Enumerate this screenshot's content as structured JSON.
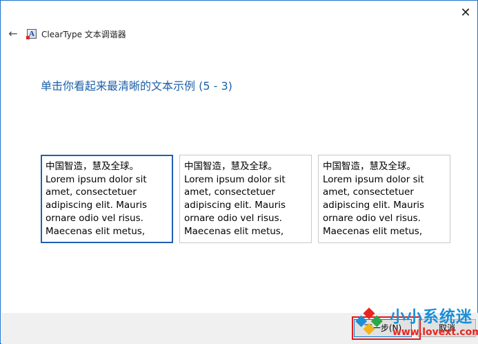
{
  "window": {
    "app_title": "ClearType 文本调谐器",
    "app_icon": "cleartype-app-icon",
    "app_icon_letter": "A",
    "close_glyph": "✕",
    "back_glyph": "←"
  },
  "instruction": "单击你看起来最清晰的文本示例 (5 - 3)",
  "samples": [
    {
      "selected": true,
      "lines": [
        "中国智造，慧及全球。",
        "Lorem ipsum dolor sit",
        "amet, consectetuer",
        "adipiscing elit. Mauris",
        "ornare odio vel risus.",
        "Maecenas elit metus,"
      ]
    },
    {
      "selected": false,
      "lines": [
        "中国智造，慧及全球。",
        "Lorem ipsum dolor sit",
        "amet, consectetuer",
        "adipiscing elit. Mauris",
        "ornare odio vel risus.",
        "Maecenas elit metus,"
      ]
    },
    {
      "selected": false,
      "lines": [
        "中国智造，慧及全球。",
        "Lorem ipsum dolor sit",
        "amet, consectetuer",
        "adipiscing elit. Mauris",
        "ornare odio vel risus.",
        "Maecenas elit metus,"
      ]
    }
  ],
  "footer": {
    "next_label": "下一步(N)",
    "cancel_label": "取消"
  },
  "watermark": {
    "title": "小小系统迷",
    "url": "www.lovext.com"
  },
  "colors": {
    "accent": "#1b5fa8",
    "selected_border": "#1f5fb0",
    "highlight": "#e21b1b",
    "watermark_blue": "#1c8fd6",
    "watermark_red": "#e8261f"
  }
}
